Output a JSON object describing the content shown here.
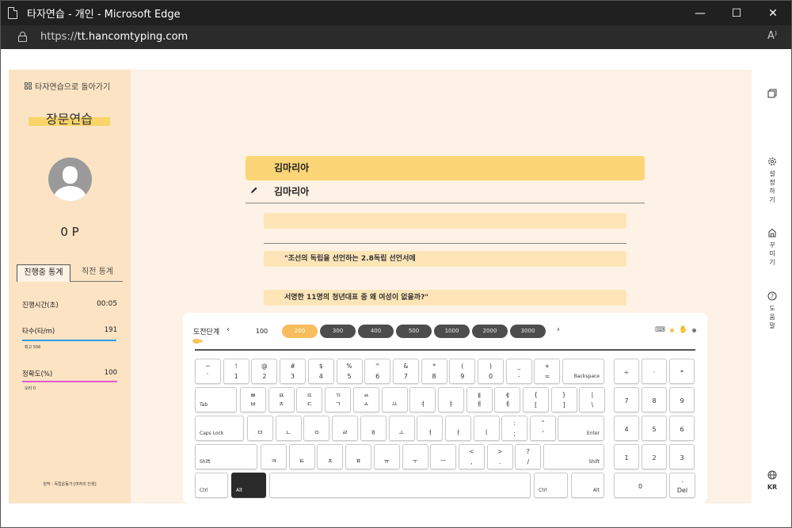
{
  "window": {
    "title": "타자연습 - 개인 - Microsoft Edge",
    "controls": {
      "minimize": "—",
      "maximize": "☐",
      "close": "✕"
    }
  },
  "address": {
    "scheme": "https://",
    "host": "tt.hancomtyping.com",
    "read_aloud": "A⁾"
  },
  "sidebar": {
    "back_label": "타자연습으로 돌아가기",
    "mode_title": "장문연습",
    "points": "0 P",
    "tabs": [
      "진행중 통계",
      "직전 통계"
    ],
    "stats": {
      "elapsed_label": "진행시간(초)",
      "elapsed_value": "00:05",
      "speed_label": "타수(타/m)",
      "speed_value": "191",
      "speed_sub": "최고 556",
      "speed_fill": 0.99,
      "accuracy_label": "정확도(%)",
      "accuracy_value": "100",
      "accuracy_sub": "오타 0",
      "accuracy_fill": 1.0
    },
    "footer": "원작 : 독립운동가 [여자의 인생]",
    "colors": {
      "speed": "#2e9be5",
      "accuracy": "#e25bd0"
    }
  },
  "practice": {
    "target_text": "김마리아",
    "typed_text": "김마리아",
    "lines": [
      "",
      "\"조선의 독립을 선언하는 2.8독립 선언서에",
      "서명한 11명의 청년대표 중 왜 여성이 없을까?\""
    ]
  },
  "keyboard": {
    "stage_label": "도전단계",
    "prev": "‹",
    "next": "›",
    "stages": [
      "100",
      "200",
      "300",
      "400",
      "500",
      "1000",
      "2000",
      "3000"
    ],
    "current_stage": "200",
    "accent": "#f8bd5c",
    "rows": [
      [
        [
          "~",
          "`"
        ],
        [
          "!",
          "1"
        ],
        [
          "@",
          "2"
        ],
        [
          "#",
          "3"
        ],
        [
          "$",
          "4"
        ],
        [
          "%",
          "5"
        ],
        [
          "^",
          "6"
        ],
        [
          "&",
          "7"
        ],
        [
          "*",
          "8"
        ],
        [
          "(",
          "9"
        ],
        [
          ")",
          "0"
        ],
        [
          "_",
          "-"
        ],
        [
          "+",
          "="
        ]
      ],
      [
        [
          "ㅃ",
          "ㅂ"
        ],
        [
          "ㅉ",
          "ㅈ"
        ],
        [
          "ㄸ",
          "ㄷ"
        ],
        [
          "ㄲ",
          "ㄱ"
        ],
        [
          "ㅆ",
          "ㅅ"
        ],
        [
          "",
          "ㅛ"
        ],
        [
          "",
          "ㅕ"
        ],
        [
          "",
          "ㅑ"
        ],
        [
          "ㅒ",
          "ㅐ"
        ],
        [
          "ㅖ",
          "ㅔ"
        ],
        [
          "{",
          "["
        ],
        [
          "}",
          "]"
        ],
        [
          "|",
          "\\"
        ]
      ],
      [
        [
          "",
          "ㅁ"
        ],
        [
          "",
          "ㄴ"
        ],
        [
          "",
          "ㅇ"
        ],
        [
          "",
          "ㄹ"
        ],
        [
          "",
          "ㅎ"
        ],
        [
          "",
          "ㅗ"
        ],
        [
          "",
          "ㅓ"
        ],
        [
          "",
          "ㅏ"
        ],
        [
          "",
          "ㅣ"
        ],
        [
          ":",
          ";"
        ],
        [
          "\"",
          "'"
        ]
      ],
      [
        [
          "",
          "ㅋ"
        ],
        [
          "",
          "ㅌ"
        ],
        [
          "",
          "ㅊ"
        ],
        [
          "",
          "ㅍ"
        ],
        [
          "",
          "ㅠ"
        ],
        [
          "",
          "ㅜ"
        ],
        [
          "",
          "ㅡ"
        ],
        [
          "<",
          ","
        ],
        [
          ">",
          "."
        ],
        [
          "?",
          "/"
        ]
      ]
    ],
    "special": {
      "backspace": "Backspace",
      "tab": "Tab",
      "caps": "Caps Lock",
      "enter": "Enter",
      "shift_l": "Shift",
      "shift_r": "Shift",
      "ctrl_l": "Ctrl",
      "alt_l": "Alt",
      "ctrl_r": "Ctrl",
      "alt_r": "Alt"
    },
    "numpad": [
      [
        "÷",
        "·",
        "*"
      ],
      [
        "7",
        "8",
        "9"
      ],
      [
        "4",
        "5",
        "6"
      ],
      [
        "1",
        "2",
        "3"
      ]
    ],
    "numpad_zero": "0",
    "numpad_del_top": ".",
    "numpad_del": "Del"
  },
  "rightbar": {
    "settings": "설\n정\n하\n기",
    "decorate": "꾸\n미\n기",
    "help": "도\n움\n말",
    "lang": "KR"
  }
}
